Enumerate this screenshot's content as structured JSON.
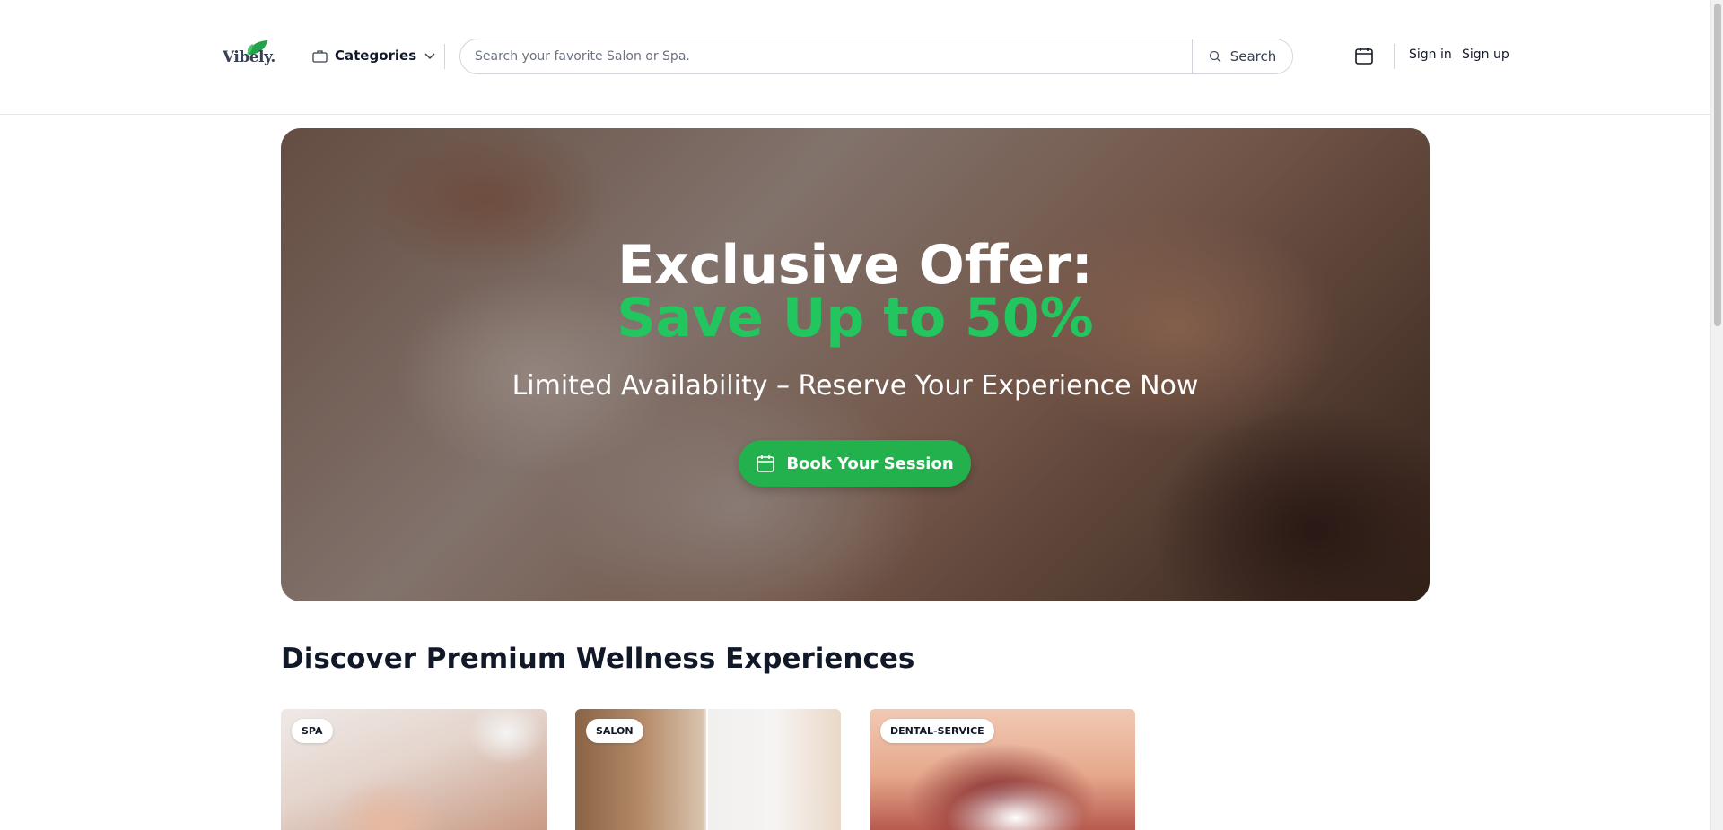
{
  "header": {
    "logo_text": "Vibely.",
    "categories_label": "Categories",
    "search": {
      "placeholder": "Search your favorite Salon or Spa.",
      "button_label": "Search"
    },
    "sign_in": "Sign in",
    "sign_up": "Sign up"
  },
  "hero": {
    "title_line1": "Exclusive Offer:",
    "title_line2": "Save Up to 50%",
    "subtitle": "Limited Availability – Reserve Your Experience Now",
    "cta_label": "Book Your Session"
  },
  "section": {
    "title": "Discover Premium Wellness Experiences",
    "cards": [
      {
        "badge": "SPA"
      },
      {
        "badge": "SALON"
      },
      {
        "badge": "DENTAL-SERVICE"
      }
    ]
  },
  "colors": {
    "accent_green": "#22c55e",
    "button_green": "#22b14c"
  }
}
